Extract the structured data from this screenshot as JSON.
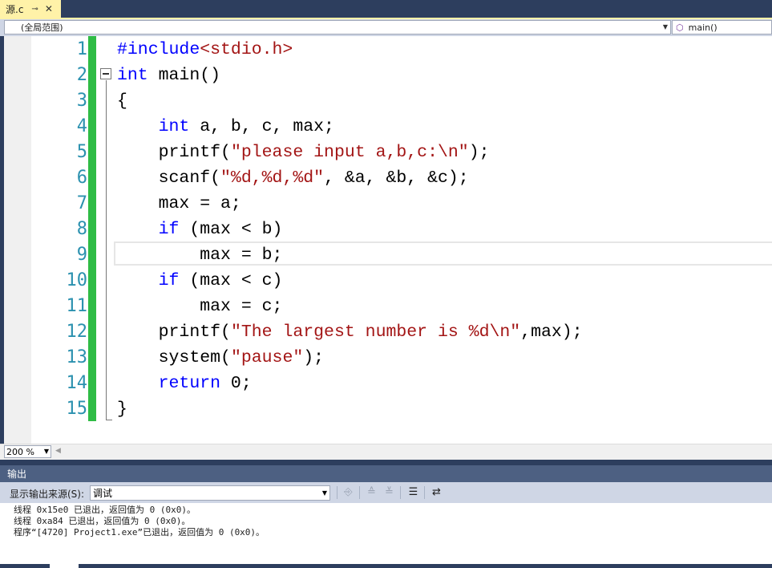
{
  "tab": {
    "title": "源.c",
    "pin_icon": "⊸",
    "close_icon": "✕"
  },
  "navbar": {
    "scope": "(全局范围)",
    "function": "main()"
  },
  "editor": {
    "line_numbers": [
      "1",
      "2",
      "3",
      "4",
      "5",
      "6",
      "7",
      "8",
      "9",
      "10",
      "11",
      "12",
      "13",
      "14",
      "15"
    ],
    "lines": [
      [
        {
          "t": "#include",
          "c": "kw"
        },
        {
          "t": "<stdio.h>",
          "c": "str"
        }
      ],
      [
        {
          "t": "int",
          "c": "kw"
        },
        {
          "t": " main()",
          "c": ""
        }
      ],
      [
        {
          "t": "{",
          "c": ""
        }
      ],
      [
        {
          "t": "    ",
          "c": ""
        },
        {
          "t": "int",
          "c": "kw"
        },
        {
          "t": " a, b, c, max;",
          "c": ""
        }
      ],
      [
        {
          "t": "    printf(",
          "c": ""
        },
        {
          "t": "\"please input a,b,c:\\n\"",
          "c": "str"
        },
        {
          "t": ");",
          "c": ""
        }
      ],
      [
        {
          "t": "    scanf(",
          "c": ""
        },
        {
          "t": "\"%d,%d,%d\"",
          "c": "str"
        },
        {
          "t": ", &a, &b, &c);",
          "c": ""
        }
      ],
      [
        {
          "t": "    max = a;",
          "c": ""
        }
      ],
      [
        {
          "t": "    ",
          "c": ""
        },
        {
          "t": "if",
          "c": "kw"
        },
        {
          "t": " (max < b)",
          "c": ""
        }
      ],
      [
        {
          "t": "        max = b;",
          "c": ""
        }
      ],
      [
        {
          "t": "    ",
          "c": ""
        },
        {
          "t": "if",
          "c": "kw"
        },
        {
          "t": " (max < c)",
          "c": ""
        }
      ],
      [
        {
          "t": "        max = c;",
          "c": ""
        }
      ],
      [
        {
          "t": "    printf(",
          "c": ""
        },
        {
          "t": "\"The largest number is %d\\n\"",
          "c": "str"
        },
        {
          "t": ",max);",
          "c": ""
        }
      ],
      [
        {
          "t": "    system(",
          "c": ""
        },
        {
          "t": "\"pause\"",
          "c": "str"
        },
        {
          "t": ");",
          "c": ""
        }
      ],
      [
        {
          "t": "    ",
          "c": ""
        },
        {
          "t": "return",
          "c": "kw"
        },
        {
          "t": " 0;",
          "c": ""
        }
      ],
      [
        {
          "t": "}",
          "c": ""
        }
      ]
    ],
    "zoom": "200 %"
  },
  "output": {
    "title": "输出",
    "source_label": "显示输出来源(S):",
    "source_value": "调试",
    "lines": [
      "线程 0x15e0 已退出，返回值为 0 (0x0)。",
      "线程 0xa84 已退出，返回值为 0 (0x0)。",
      "程序“[4720] Project1.exe”已退出，返回值为 0 (0x0)。"
    ]
  },
  "colors": {
    "keyword": "#0000ff",
    "string": "#a31515",
    "line_number": "#2b91af",
    "change_bar": "#2fbc45",
    "tab_active": "#fff2a8"
  }
}
